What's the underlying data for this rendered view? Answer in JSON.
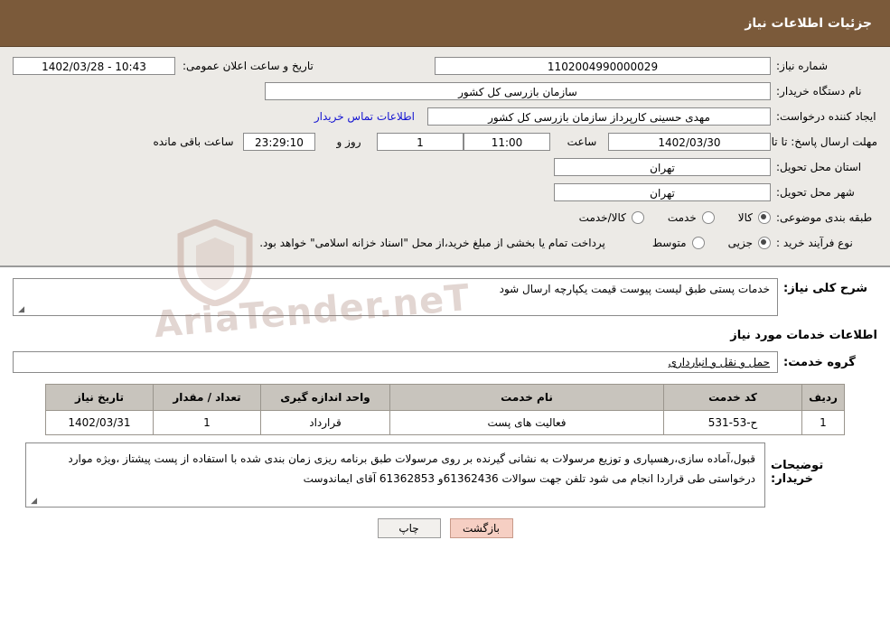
{
  "header": {
    "title": "جزئیات اطلاعات نیاز"
  },
  "details": {
    "need_no_label": "شماره نیاز:",
    "need_no_value": "1102004990000029",
    "public_date_label": "تاریخ و ساعت اعلان عمومی:",
    "public_date_value": "10:43 - 1402/03/28",
    "buyer_org_label": "نام دستگاه خریدار:",
    "buyer_org_value": "سازمان بازرسی کل کشور",
    "creator_label": "ایجاد کننده درخواست:",
    "creator_value": "مهدی حسینی کارپرداز سازمان بازرسی کل کشور",
    "contact_link": "اطلاعات تماس خریدار",
    "deadline_label": "مهلت ارسال پاسخ: تا تاریخ:",
    "deadline_date": "1402/03/30",
    "hour_label": "ساعت",
    "hour_value": "11:00",
    "days_value": "1",
    "days_label": "روز و",
    "timer_value": "23:29:10",
    "remaining_label": "ساعت باقی مانده",
    "province_label": "استان محل تحویل:",
    "province_value": "تهران",
    "city_label": "شهر محل تحویل:",
    "city_value": "تهران",
    "category_label": "طبقه بندی موضوعی:",
    "category_options": [
      {
        "label": "کالا",
        "checked": true
      },
      {
        "label": "خدمت",
        "checked": false
      },
      {
        "label": "کالا/خدمت",
        "checked": false
      }
    ],
    "process_label": "نوع فرآیند خرید :",
    "process_options": [
      {
        "label": "جزیی",
        "checked": true
      },
      {
        "label": "متوسط",
        "checked": false
      }
    ],
    "process_note": "پرداخت تمام یا بخشی از مبلغ خرید،از محل \"اسناد خزانه اسلامی\" خواهد بود."
  },
  "watermark": {
    "text": "AriaTender.neT"
  },
  "summary": {
    "label": "شرح کلی نیاز:",
    "value": "خدمات پستی طبق لیست پیوست قیمت یکپارچه ارسال شود"
  },
  "services_section": {
    "title": "اطلاعات خدمات مورد نیاز",
    "group_label": "گروه خدمت:",
    "group_value": "حمل و نقل و انبارداری",
    "columns": [
      "ردیف",
      "کد خدمت",
      "نام خدمت",
      "واحد اندازه گیری",
      "تعداد / مقدار",
      "تاریخ نیاز"
    ],
    "rows": [
      {
        "index": "1",
        "code": "ح-53-531",
        "name": "فعالیت های پست",
        "unit": "قرارداد",
        "qty": "1",
        "date": "1402/03/31"
      }
    ]
  },
  "buyer_notes": {
    "label": "توضیحات خریدار:",
    "value": "قبول،آماده سازی،رهسپاری و توزیع مرسولات به نشانی گیرنده بر روی مرسولات طبق برنامه ریزی زمان بندی شده با استفاده از پست پیشتاز ،ویژه  موارد درخواستی طی قراردا انجام می شود تلفن جهت سوالات 61362436و 61362853 آقای ایماندوست"
  },
  "footer": {
    "print_label": "چاپ",
    "back_label": "بازگشت"
  }
}
